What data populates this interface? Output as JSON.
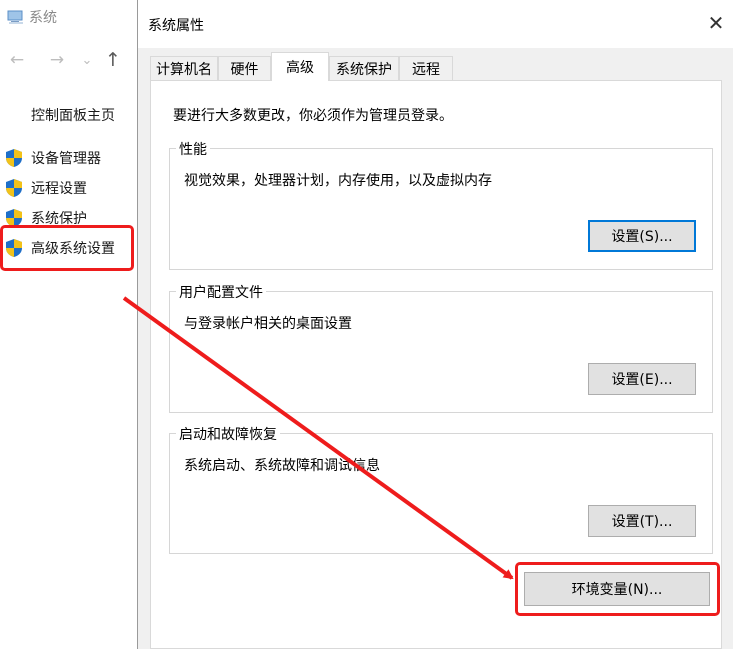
{
  "bg_window": {
    "title": "系统",
    "nav": {
      "back": "←",
      "forward": "→",
      "dropdown": "⌄",
      "up": "↑"
    },
    "home_link": "控制面板主页",
    "links": [
      "设备管理器",
      "远程设置",
      "系统保护",
      "高级系统设置"
    ]
  },
  "dialog": {
    "title": "系统属性",
    "close": "✕",
    "tabs": [
      "计算机名",
      "硬件",
      "高级",
      "系统保护",
      "远程"
    ],
    "active_tab": "高级",
    "notice": "要进行大多数更改，你必须作为管理员登录。",
    "performance": {
      "title": "性能",
      "desc": "视觉效果，处理器计划，内存使用，以及虚拟内存",
      "button": "设置(S)..."
    },
    "profiles": {
      "title": "用户配置文件",
      "desc": "与登录帐户相关的桌面设置",
      "button": "设置(E)..."
    },
    "startup": {
      "title": "启动和故障恢复",
      "desc": "系统启动、系统故障和调试信息",
      "button": "设置(T)..."
    },
    "env_button": "环境变量(N)..."
  },
  "colors": {
    "highlight_red": "#ee1c1c",
    "focus_blue": "#0078d7",
    "shield_blue": "#1f6fc8",
    "shield_yellow": "#f2c21a"
  }
}
